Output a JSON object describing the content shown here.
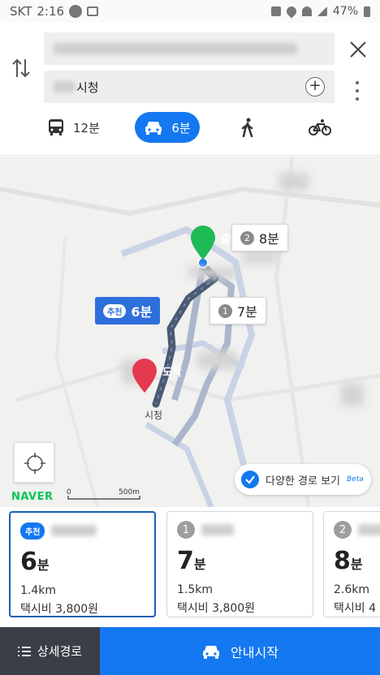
{
  "status_bar": {
    "carrier": "SKT",
    "time": "2:16",
    "battery": "47%"
  },
  "search": {
    "start_value": "",
    "destination_value": "시청",
    "add_waypoint_label": "+"
  },
  "modes": [
    {
      "id": "transit",
      "icon": "bus-icon",
      "label": "12분"
    },
    {
      "id": "car",
      "icon": "car-icon",
      "label": "6분",
      "selected": true
    },
    {
      "id": "walk",
      "icon": "walk-icon",
      "label": ""
    },
    {
      "id": "bike",
      "icon": "bike-icon",
      "label": ""
    }
  ],
  "map": {
    "start_pin": "출발",
    "end_pin": "도착",
    "recommended_bubble": {
      "tag": "추천",
      "time": "6분"
    },
    "alt1_bubble": {
      "num": "1",
      "time": "7분"
    },
    "alt2_bubble": {
      "num": "2",
      "time": "8분"
    },
    "place_label": "시청",
    "brand": "NAVER",
    "scale_zero": "0",
    "scale_label": "500m",
    "variety_toggle": {
      "label": "다양한 경로 보기",
      "badge": "Beta",
      "checked": true
    }
  },
  "cards": [
    {
      "tag": "추천",
      "time": "6",
      "unit": "분",
      "distance": "1.4km",
      "taxi": "택시비 3,800원",
      "selected": true
    },
    {
      "tag": "1",
      "time": "7",
      "unit": "분",
      "distance": "1.5km",
      "taxi": "택시비 3,800원",
      "selected": false
    },
    {
      "tag": "2",
      "time": "8",
      "unit": "분",
      "distance": "2.6km",
      "taxi": "택시비 4",
      "selected": false
    }
  ],
  "bottom": {
    "detail_label": "상세경로",
    "start_label": "안내시작"
  },
  "colors": {
    "accent": "#1478f0",
    "route": "#4a5a74",
    "start_pin": "#1db954",
    "end_pin": "#e53950",
    "dark": "#3a3f47"
  }
}
